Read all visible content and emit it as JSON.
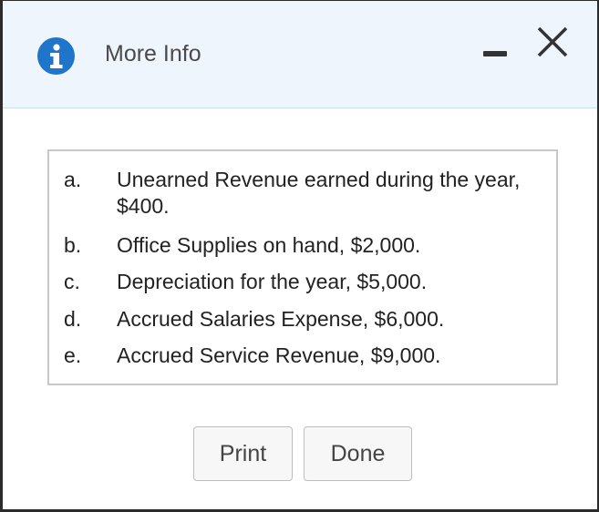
{
  "dialog": {
    "title": "More Info",
    "info_icon_char": "i",
    "colors": {
      "header_bg": "#eef5fc",
      "info_icon": "#1f75c9"
    }
  },
  "items": [
    {
      "letter": "a.",
      "text": "Unearned Revenue earned during the year, $400."
    },
    {
      "letter": "b.",
      "text": "Office Supplies on hand, $2,000."
    },
    {
      "letter": "c.",
      "text": "Depreciation for the year, $5,000."
    },
    {
      "letter": "d.",
      "text": "Accrued Salaries Expense, $6,000."
    },
    {
      "letter": "e.",
      "text": "Accrued Service Revenue, $9,000."
    }
  ],
  "buttons": {
    "print_label": "Print",
    "done_label": "Done"
  }
}
